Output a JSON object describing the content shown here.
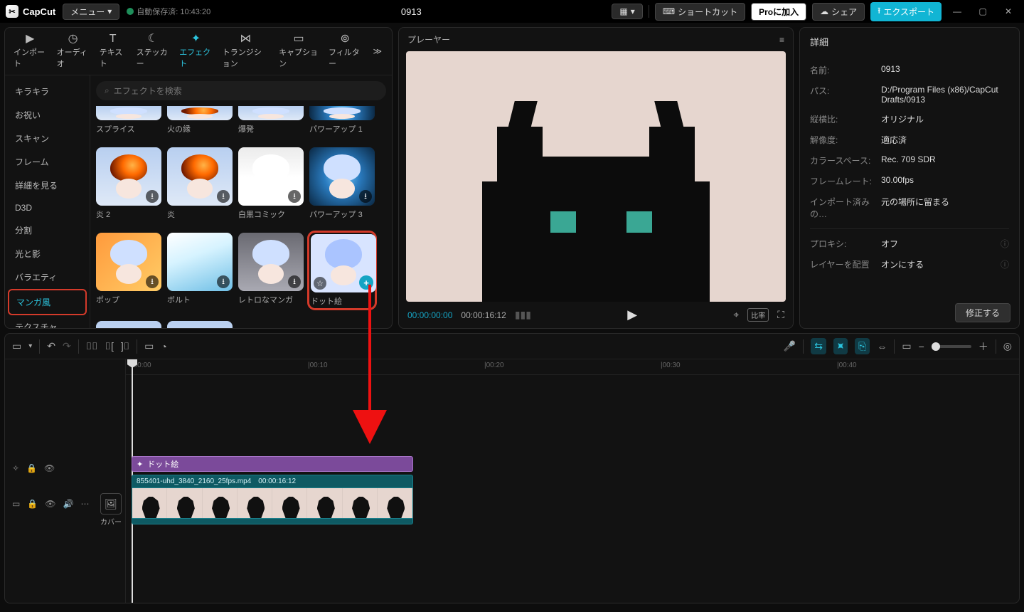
{
  "top": {
    "logo": "CapCut",
    "menu": "メニュー",
    "autosave": "自動保存済: 10:43:20",
    "title": "0913",
    "shortcut": "ショートカット",
    "pro": "Proに加入",
    "share": "シェア",
    "export": "エクスポート"
  },
  "tabs": [
    {
      "icon": "▶",
      "label": "インポート"
    },
    {
      "icon": "◷",
      "label": "オーディオ"
    },
    {
      "icon": "T",
      "label": "テキスト"
    },
    {
      "icon": "☾",
      "label": "ステッカー"
    },
    {
      "icon": "✦",
      "label": "エフェクト",
      "active": true
    },
    {
      "icon": "⋈",
      "label": "トランジション"
    },
    {
      "icon": "▭",
      "label": "キャプション"
    },
    {
      "icon": "⊚",
      "label": "フィルター"
    }
  ],
  "categories": [
    "キラキラ",
    "お祝い",
    "スキャン",
    "フレーム",
    "詳細を見る",
    "D3D",
    "分割",
    "光と影",
    "バラエティ",
    "マンガ風",
    "テクスチャ"
  ],
  "category_active_index": 9,
  "search_placeholder": "エフェクトを検索",
  "effects": [
    {
      "label": "スプライス",
      "cls": "anime-face",
      "half": true
    },
    {
      "label": "火の縁",
      "cls": "anime-face fire-overlay",
      "half": true
    },
    {
      "label": "爆発",
      "cls": "anime-face",
      "half": true
    },
    {
      "label": "パワーアップ 1",
      "cls": "anime-face swirl",
      "half": true
    },
    {
      "label": "炎 2",
      "cls": "anime-face fire-overlay",
      "dl": true
    },
    {
      "label": "炎",
      "cls": "anime-face fire-overlay",
      "dl": true
    },
    {
      "label": "白黒コミック",
      "cls": "anime-face bw-overlay",
      "dl": true
    },
    {
      "label": "パワーアップ 3",
      "cls": "anime-face swirl",
      "dl": true
    },
    {
      "label": "ポップ",
      "cls": "anime-face pop",
      "dl": true
    },
    {
      "label": "ボルト",
      "cls": "bolt",
      "dl": true
    },
    {
      "label": "レトロなマンガ",
      "cls": "anime-face retro",
      "dl": true
    },
    {
      "label": "ドット絵",
      "cls": "anime-face pixel",
      "selected": true,
      "star": true,
      "add": true
    },
    {
      "label": "",
      "cls": "anime-face fire-overlay",
      "nolabel": true
    },
    {
      "label": "",
      "cls": "anime-face",
      "nolabel": true
    }
  ],
  "player": {
    "title": "プレーヤー",
    "time_cur": "00:00:00:00",
    "time_total": "00:00:16:12"
  },
  "details": {
    "title": "詳細",
    "rows": [
      {
        "k": "名前:",
        "v": "0913"
      },
      {
        "k": "パス:",
        "v": "D:/Program Files (x86)/CapCut Drafts/0913"
      },
      {
        "k": "縦横比:",
        "v": "オリジナル"
      },
      {
        "k": "解像度:",
        "v": "適応済"
      },
      {
        "k": "カラースペース:",
        "v": "Rec. 709 SDR"
      },
      {
        "k": "フレームレート:",
        "v": "30.00fps"
      },
      {
        "k": "インポート済みの…",
        "v": "元の場所に留まる"
      }
    ],
    "extra": [
      {
        "k": "プロキシ:",
        "v": "オフ",
        "info": true
      },
      {
        "k": "レイヤーを配置",
        "v": "オンにする",
        "info": true
      }
    ],
    "fix": "修正する"
  },
  "timeline": {
    "ruler": [
      "00:00",
      "00:10",
      "00:20",
      "00:30",
      "00:40"
    ],
    "effect_clip": "ドット絵",
    "clip_name": "855401-uhd_3840_2160_25fps.mp4",
    "clip_dur": "00:00:16:12",
    "cover": "カバー"
  }
}
